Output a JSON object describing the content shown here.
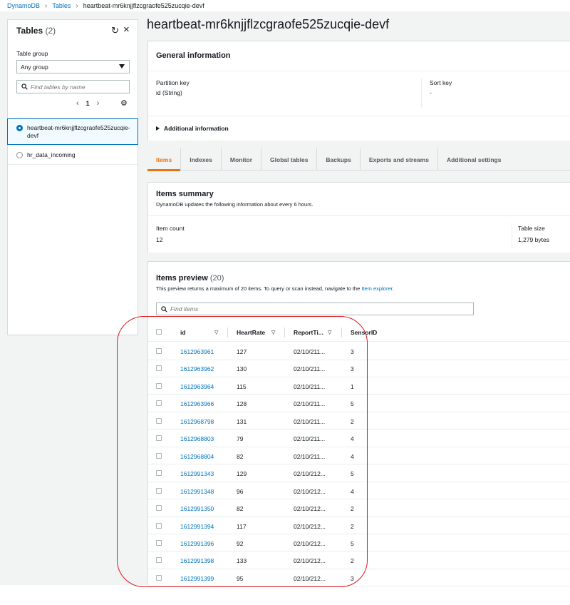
{
  "breadcrumb": {
    "items": [
      "DynamoDB",
      "Tables"
    ],
    "current": "heartbeat-mr6knjjflzcgraofe525zucqie-devf"
  },
  "sidebar": {
    "title": "Tables",
    "count": "(2)",
    "table_group_label": "Table group",
    "table_group_value": "Any group",
    "search_placeholder": "Find tables by name",
    "page": "1",
    "tables": [
      {
        "name": "heartbeat-mr6knjjflzcgraofe525zucqie-devf",
        "selected": true
      },
      {
        "name": "hr_data_incoming",
        "selected": false
      }
    ]
  },
  "main": {
    "title": "heartbeat-mr6knjjflzcgraofe525zucqie-devf",
    "general": {
      "heading": "General information",
      "partition_key_label": "Partition key",
      "partition_key_value": "id (String)",
      "sort_key_label": "Sort key",
      "sort_key_value": "-",
      "additional_info": "Additional information"
    },
    "tabs": [
      "Items",
      "Indexes",
      "Monitor",
      "Global tables",
      "Backups",
      "Exports and streams",
      "Additional settings"
    ],
    "active_tab": "Items",
    "summary": {
      "heading": "Items summary",
      "description": "DynamoDB updates the following information about every 6 hours.",
      "item_count_label": "Item count",
      "item_count_value": "12",
      "table_size_label": "Table size",
      "table_size_value": "1,279 bytes"
    },
    "preview": {
      "heading": "Items preview",
      "count": "(20)",
      "description": "This preview returns a maximum of 20 items. To query or scan instead, navigate to the",
      "description_link": "Item explorer",
      "description_end": ".",
      "search_placeholder": "Find items",
      "columns": [
        "id",
        "HeartRate",
        "ReportTi...",
        "SensorID"
      ],
      "rows": [
        {
          "id": "1612963961",
          "hr": "127",
          "time": "02/10/211...",
          "sensor": "3"
        },
        {
          "id": "1612963962",
          "hr": "130",
          "time": "02/10/211...",
          "sensor": "3"
        },
        {
          "id": "1612963964",
          "hr": "115",
          "time": "02/10/211...",
          "sensor": "1"
        },
        {
          "id": "1612963966",
          "hr": "128",
          "time": "02/10/211...",
          "sensor": "5"
        },
        {
          "id": "1612968798",
          "hr": "131",
          "time": "02/10/211...",
          "sensor": "2"
        },
        {
          "id": "1612968803",
          "hr": "79",
          "time": "02/10/211...",
          "sensor": "4"
        },
        {
          "id": "1612968804",
          "hr": "82",
          "time": "02/10/211...",
          "sensor": "4"
        },
        {
          "id": "1612991343",
          "hr": "129",
          "time": "02/10/212...",
          "sensor": "5"
        },
        {
          "id": "1612991348",
          "hr": "96",
          "time": "02/10/212...",
          "sensor": "4"
        },
        {
          "id": "1612991350",
          "hr": "82",
          "time": "02/10/212...",
          "sensor": "2"
        },
        {
          "id": "1612991394",
          "hr": "117",
          "time": "02/10/212...",
          "sensor": "2"
        },
        {
          "id": "1612991396",
          "hr": "92",
          "time": "02/10/212...",
          "sensor": "5"
        },
        {
          "id": "1612991398",
          "hr": "133",
          "time": "02/10/212...",
          "sensor": "2"
        },
        {
          "id": "1612991399",
          "hr": "95",
          "time": "02/10/212...",
          "sensor": "3"
        }
      ]
    }
  },
  "colors": {
    "link": "#0073bb",
    "active_tab": "#ec7211",
    "annotation": "#e0161b"
  }
}
